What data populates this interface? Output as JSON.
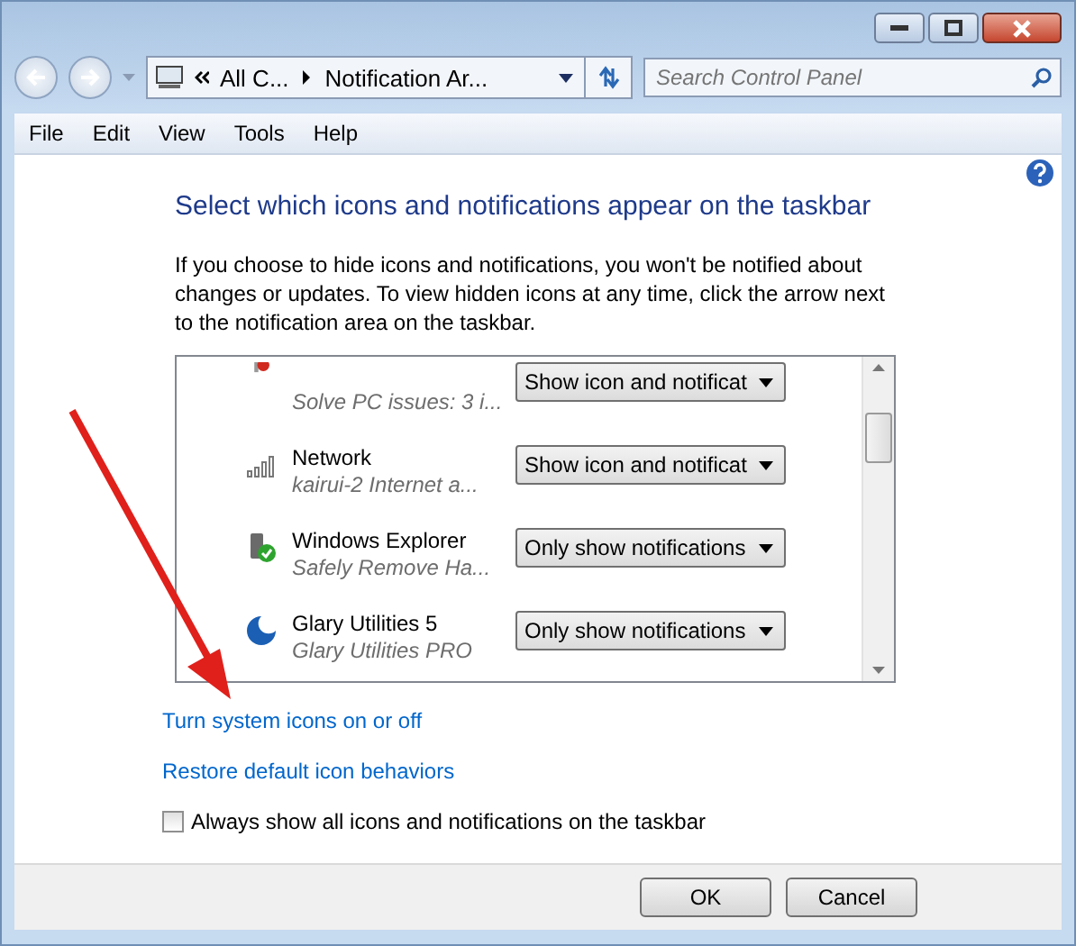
{
  "address_bar": {
    "crumbs": [
      "All C...",
      "Notification Ar..."
    ]
  },
  "search": {
    "placeholder": "Search Control Panel"
  },
  "menu": [
    "File",
    "Edit",
    "View",
    "Tools",
    "Help"
  ],
  "heading": "Select which icons and notifications appear on the taskbar",
  "description": "If you choose to hide icons and notifications, you won't be notified about changes or updates. To view hidden icons at any time, click the arrow next to the notification area on the taskbar.",
  "icons_list": [
    {
      "kind": "alert",
      "subtitle": "Solve PC issues: 3 i...",
      "behavior": "Show icon and notificat"
    },
    {
      "kind": "network",
      "name": "Network",
      "subtitle": "kairui-2 Internet a...",
      "behavior": "Show icon and notificat"
    },
    {
      "kind": "usb",
      "name": "Windows Explorer",
      "subtitle": "Safely Remove Ha...",
      "behavior": "Only show notifications"
    },
    {
      "kind": "glary",
      "name": "Glary Utilities 5",
      "subtitle": "Glary Utilities PRO",
      "behavior": "Only show notifications"
    }
  ],
  "links": [
    "Turn system icons on or off",
    "Restore default icon behaviors"
  ],
  "always_show": {
    "label": "Always show all icons and notifications on the taskbar",
    "checked": false
  },
  "buttons": [
    "OK",
    "Cancel"
  ]
}
